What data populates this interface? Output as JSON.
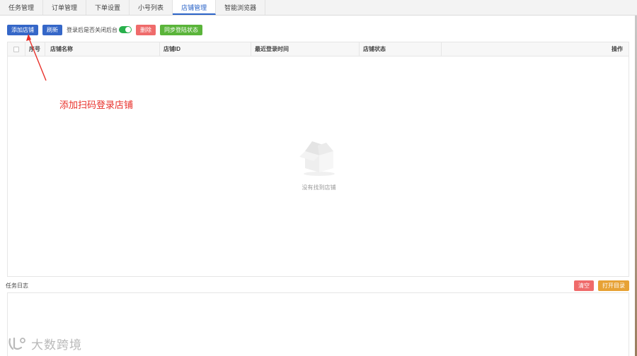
{
  "tabs": [
    {
      "label": "任务管理",
      "active": false
    },
    {
      "label": "订单管理",
      "active": false
    },
    {
      "label": "下单设置",
      "active": false
    },
    {
      "label": "小号列表",
      "active": false
    },
    {
      "label": "店铺管理",
      "active": true
    },
    {
      "label": "智能浏览器",
      "active": false
    }
  ],
  "toolbar": {
    "add_shop_label": "添加店铺",
    "refresh_label": "刷新",
    "close_after_login_label": "登录后是否关闭后台",
    "close_after_login_on": true,
    "delete_label": "删除",
    "sync_status_label": "同步登陆状态"
  },
  "table": {
    "columns": [
      "序号",
      "店铺名称",
      "店铺ID",
      "最近登录时间",
      "店铺状态",
      "操作"
    ],
    "rows": [],
    "empty_text": "没有找到店铺"
  },
  "annotation": {
    "text": "添加扫码登录店铺",
    "color": "#e8302a"
  },
  "log": {
    "title": "任务日志",
    "clear_label": "清空",
    "open_dir_label": "打开目录"
  },
  "watermark": {
    "text": "大数跨境"
  },
  "colors": {
    "primary": "#3567c8",
    "danger": "#ef6b6b",
    "success": "#5ab43a",
    "warning": "#e7a235",
    "toggle_on": "#28b04c"
  }
}
